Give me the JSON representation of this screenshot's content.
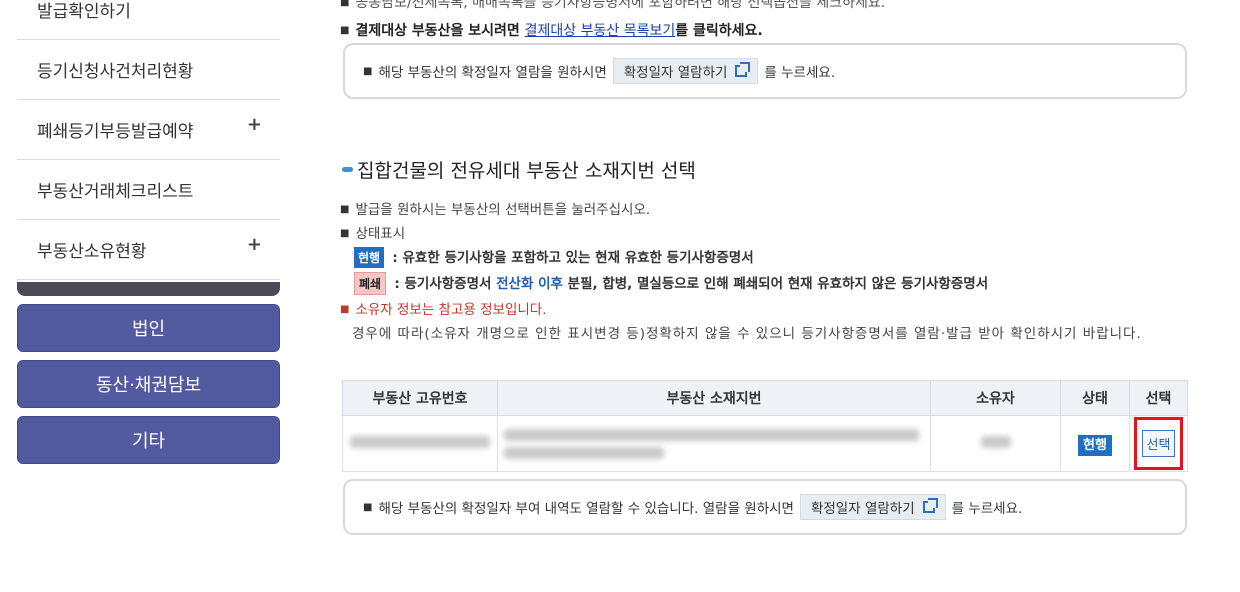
{
  "sidebar": {
    "items": [
      {
        "label": "발급확인하기",
        "expandable": false
      },
      {
        "label": "등기신청사건처리현황",
        "expandable": false
      },
      {
        "label": "폐쇄등기부등발급예약",
        "expandable": true
      },
      {
        "label": "부동산거래체크리스트",
        "expandable": false
      },
      {
        "label": "부동산소유현황",
        "expandable": true
      }
    ],
    "plus_symbol": "+",
    "buttons": [
      "법인",
      "동산·채권담보",
      "기타"
    ]
  },
  "top": {
    "line1": "공동담보/전세목록, 매매목록을 등기사항증명서에 포함하려면 해당 선택옵션을 체크하세요.",
    "line2_prefix": "결제대상 부동산을 보시려면",
    "line2_link": "결제대상 부동산 목록보기",
    "line2_suffix": "를 클릭하세요."
  },
  "notice1": {
    "prefix": "해당 부동산의 확정일자 열람을 원하시면",
    "button": "확정일자 열람하기",
    "suffix": "를 누르세요."
  },
  "section": {
    "title": "집합건물의 전유세대 부동산 소재지번 선택",
    "instruction": "발급을 원하시는 부동산의 선택버튼을 눌러주십시오.",
    "status_heading": "상태표시",
    "status_current_badge": "현행",
    "status_current_desc": ": 유효한 등기사항을 포함하고 있는 현재 유효한 등기사항증명서",
    "status_closed_badge": "폐쇄",
    "status_closed_desc_a": ": 등기사항증명서",
    "status_closed_desc_blue": "전산화 이후",
    "status_closed_desc_b": "분필, 합병, 멸실등으로 인해 폐쇄되어 현재 유효하지 않은 등기사항증명서",
    "owner_warning": "소유자 정보는 참고용 정보입니다.",
    "owner_note": "경우에 따라(소유자 개명으로 인한 표시변경 등)정확하지 않을 수 있으니 등기사항증명서를 열람·발급 받아 확인하시기 바랍니다."
  },
  "table": {
    "headers": [
      "부동산 고유번호",
      "부동산 소재지번",
      "소유자",
      "상태",
      "선택"
    ],
    "rows": [
      {
        "status": "현행",
        "select_label": "선택"
      }
    ]
  },
  "notice2": {
    "prefix": "해당 부동산의 확정일자 부여 내역도 열람할 수 있습니다. 열람을 원하시면",
    "button": "확정일자 열람하기",
    "suffix": "를 누르세요."
  },
  "colors": {
    "sidebar_button": "#525b9f",
    "status_current": "#1f6fc2",
    "status_closed": "#f6c6c6",
    "highlight": "#e3151b",
    "link": "#1e3fa8"
  }
}
